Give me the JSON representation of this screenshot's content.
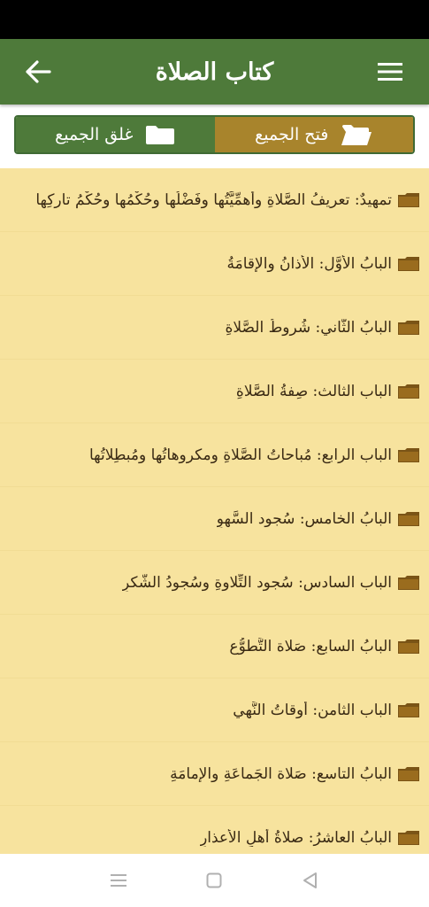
{
  "app_bar": {
    "title": "كتاب الصلاة"
  },
  "toggles": {
    "expand_all": "فتح الجميع",
    "collapse_all": "غلق الجميع"
  },
  "colors": {
    "header_green": "#4e7a3a",
    "expand_gold": "#a8842c",
    "list_background": "#f7e39e",
    "folder_brown": "#7a5416"
  },
  "chapters": [
    {
      "label": "تمهيدٌ: تعريفُ الصَّلاةِ وأهمِّيَّتُها وفَضْلُها وحُكْمُها وحُكْمُ تاركِها",
      "icon": "folder-icon"
    },
    {
      "label": "البابُ الأوَّل: الأذانُ والإقامَةُ",
      "icon": "folder-icon"
    },
    {
      "label": "البابُ الثَّاني: شُروطُ الصَّلاةِ",
      "icon": "folder-icon"
    },
    {
      "label": "الباب الثالث: صِفةُ الصَّلاةِ",
      "icon": "folder-icon"
    },
    {
      "label": "الباب الرابع: مُباحاتُ الصَّلاةِ ومكروهاتُها ومُبطِلاتُها",
      "icon": "folder-icon"
    },
    {
      "label": "البابُ الخامس: سُجود السَّهوِ",
      "icon": "folder-icon"
    },
    {
      "label": "الباب السادس: سُجود التِّلاوةِ وسُجودُ الشُّكرِ",
      "icon": "folder-icon"
    },
    {
      "label": "البابُ السابع: صَلاة التَّطوُّع",
      "icon": "folder-icon"
    },
    {
      "label": "الباب الثامن: أوقاتُ النَّهي",
      "icon": "folder-icon"
    },
    {
      "label": "البابُ التاسع: صَلاة الجَماعَةِ والإمامَةِ",
      "icon": "folder-icon"
    },
    {
      "label": "البابُ العاشرُ: صلاةُ أهلِ الأعذارِ",
      "icon": "folder-icon"
    }
  ]
}
